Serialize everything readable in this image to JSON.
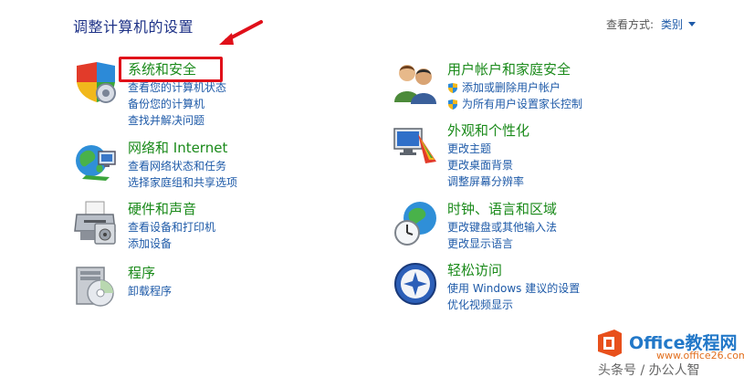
{
  "header": {
    "title": "调整计算机的设置",
    "view_by_label": "查看方式:",
    "view_by_value": "类别"
  },
  "left_column": [
    {
      "title": "系统和安全",
      "icon": "shield-security-icon",
      "links": [
        "查看您的计算机状态",
        "备份您的计算机",
        "查找并解决问题"
      ]
    },
    {
      "title": "网络和 Internet",
      "icon": "network-globe-icon",
      "links": [
        "查看网络状态和任务",
        "选择家庭组和共享选项"
      ]
    },
    {
      "title": "硬件和声音",
      "icon": "printer-icon",
      "links": [
        "查看设备和打印机",
        "添加设备"
      ]
    },
    {
      "title": "程序",
      "icon": "programs-disk-icon",
      "links": [
        "卸载程序"
      ]
    }
  ],
  "right_column": [
    {
      "title": "用户帐户和家庭安全",
      "icon": "users-icon",
      "links": [
        "添加或删除用户帐户",
        "为所有用户设置家长控制"
      ],
      "shield_links": [
        true,
        true
      ]
    },
    {
      "title": "外观和个性化",
      "icon": "display-palette-icon",
      "links": [
        "更改主题",
        "更改桌面背景",
        "调整屏幕分辨率"
      ]
    },
    {
      "title": "时钟、语言和区域",
      "icon": "clock-globe-icon",
      "links": [
        "更改键盘或其他输入法",
        "更改显示语言"
      ]
    },
    {
      "title": "轻松访问",
      "icon": "ease-of-access-icon",
      "links": [
        "使用 Windows 建议的设置",
        "优化视频显示"
      ]
    }
  ],
  "watermark": {
    "logo_text": "Office教程网",
    "url": "www.office26.com",
    "footer": "头条号 / 办公人智"
  },
  "colors": {
    "title": "#1e3287",
    "category_title": "#1a8a1a",
    "link": "#1e5aa8",
    "highlight": "#e0101a"
  }
}
